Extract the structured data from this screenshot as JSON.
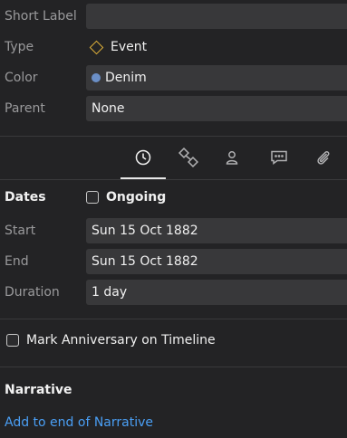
{
  "fields": {
    "short_label": {
      "label": "Short Label",
      "value": ""
    },
    "type": {
      "label": "Type",
      "value": "Event",
      "icon": "diamond-icon",
      "icon_color": "#e2b23a"
    },
    "color": {
      "label": "Color",
      "value": "Denim",
      "swatch": "#6b8fc7"
    },
    "parent": {
      "label": "Parent",
      "value": "None"
    }
  },
  "tabs": [
    {
      "name": "clock-icon",
      "active": true
    },
    {
      "name": "relationship-icon",
      "active": false
    },
    {
      "name": "person-icon",
      "active": false
    },
    {
      "name": "comment-icon",
      "active": false
    },
    {
      "name": "paperclip-icon",
      "active": false
    }
  ],
  "dates": {
    "section_label": "Dates",
    "ongoing_label": "Ongoing",
    "ongoing_checked": false,
    "start": {
      "label": "Start",
      "value": "Sun 15 Oct 1882"
    },
    "end": {
      "label": "End",
      "value": "Sun 15 Oct 1882"
    },
    "duration": {
      "label": "Duration",
      "value": "1 day"
    }
  },
  "anniversary": {
    "label": "Mark Anniversary on Timeline",
    "checked": false
  },
  "narrative": {
    "section_label": "Narrative",
    "link_label": "Add to end of Narrative",
    "link_color": "#4a9ff5"
  }
}
